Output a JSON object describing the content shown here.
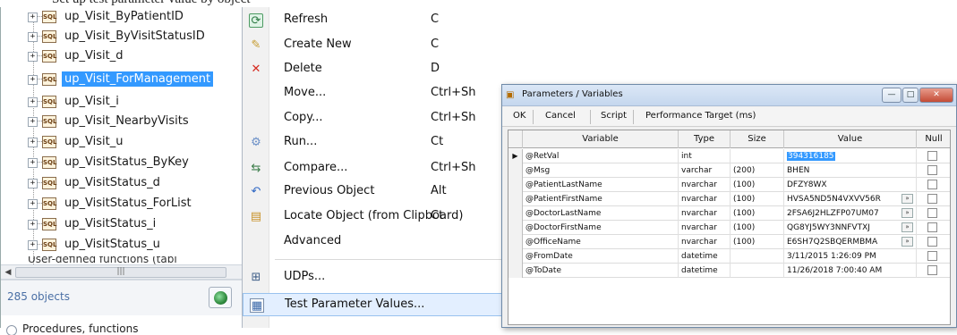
{
  "caption_text": "Set up test parameter value by object",
  "tree": {
    "items": [
      {
        "label": "up_Visit_ByPatientID",
        "selected": false
      },
      {
        "label": "up_Visit_ByVisitStatusID",
        "selected": false
      },
      {
        "label": "up_Visit_d",
        "selected": false
      },
      {
        "label": "up_Visit_ForManagement",
        "selected": true
      },
      {
        "label": "up_Visit_i",
        "selected": false
      },
      {
        "label": "up_Visit_NearbyVisits",
        "selected": false
      },
      {
        "label": "up_Visit_u",
        "selected": false
      },
      {
        "label": "up_VisitStatus_ByKey",
        "selected": false
      },
      {
        "label": "up_VisitStatus_d",
        "selected": false
      },
      {
        "label": "up_VisitStatus_ForList",
        "selected": false
      },
      {
        "label": "up_VisitStatus_i",
        "selected": false
      },
      {
        "label": "up_VisitStatus_u",
        "selected": false
      }
    ],
    "truncated_item": "User-defined functions (tabl",
    "object_count": "285 objects",
    "radio_label": "Procedures, functions"
  },
  "menu": {
    "items": [
      {
        "label": "Refresh",
        "shortcut": "C",
        "icon": "refresh-icon"
      },
      {
        "label": "Create New",
        "shortcut": "C",
        "icon": "create-new-icon"
      },
      {
        "label": "Delete",
        "shortcut": "D",
        "icon": "delete-icon"
      },
      {
        "label": "Move...",
        "shortcut": "Ctrl+Sh",
        "icon": ""
      },
      {
        "label": "Copy...",
        "shortcut": "Ctrl+Sh",
        "icon": ""
      },
      {
        "label": "Run...",
        "shortcut": "Ct",
        "icon": "run-icon"
      },
      {
        "label": "Compare...",
        "shortcut": "Ctrl+Sh",
        "icon": "compare-icon"
      },
      {
        "label": "Previous Object",
        "shortcut": "Alt",
        "icon": "previous-object-icon"
      },
      {
        "label": "Locate Object (from Clipboard)",
        "shortcut": "Ct",
        "icon": "locate-object-icon"
      },
      {
        "label": "Advanced",
        "shortcut": "",
        "icon": ""
      },
      {
        "label": "UDPs...",
        "shortcut": "",
        "icon": "udp-icon"
      },
      {
        "label": "Test Parameter Values...",
        "shortcut": "",
        "icon": "test-parameter-icon"
      }
    ]
  },
  "dialog": {
    "title": "Parameters / Variables",
    "toolbar": {
      "ok": "OK",
      "cancel": "Cancel",
      "script": "Script",
      "performance": "Performance Target (ms)"
    },
    "columns": {
      "variable": "Variable",
      "type": "Type",
      "size": "Size",
      "value": "Value",
      "null": "Null"
    },
    "rows": [
      {
        "variable": "@RetVal",
        "type": "int",
        "size": "",
        "value": "394316185",
        "current": true,
        "ellipsis": false
      },
      {
        "variable": "@Msg",
        "type": "varchar",
        "size": "(200)",
        "value": "BHEN",
        "current": false,
        "ellipsis": false
      },
      {
        "variable": "@PatientLastName",
        "type": "nvarchar",
        "size": "(100)",
        "value": "DFZY8WX",
        "current": false,
        "ellipsis": false
      },
      {
        "variable": "@PatientFirstName",
        "type": "nvarchar",
        "size": "(100)",
        "value": "HVSA5ND5N4VXVV56R",
        "current": false,
        "ellipsis": true
      },
      {
        "variable": "@DoctorLastName",
        "type": "nvarchar",
        "size": "(100)",
        "value": "2FSA6J2HLZFP07UM07",
        "current": false,
        "ellipsis": true
      },
      {
        "variable": "@DoctorFirstName",
        "type": "nvarchar",
        "size": "(100)",
        "value": "QG8YJ5WY3NNFVTXJ",
        "current": false,
        "ellipsis": true
      },
      {
        "variable": "@OfficeName",
        "type": "nvarchar",
        "size": "(100)",
        "value": "E6SH7Q2SBQERMBMA",
        "current": false,
        "ellipsis": true
      },
      {
        "variable": "@FromDate",
        "type": "datetime",
        "size": "",
        "value": "3/11/2015 1:26:09 PM",
        "current": false,
        "ellipsis": false
      },
      {
        "variable": "@ToDate",
        "type": "datetime",
        "size": "",
        "value": "11/26/2018 7:00:40 AM",
        "current": false,
        "ellipsis": false
      }
    ]
  }
}
